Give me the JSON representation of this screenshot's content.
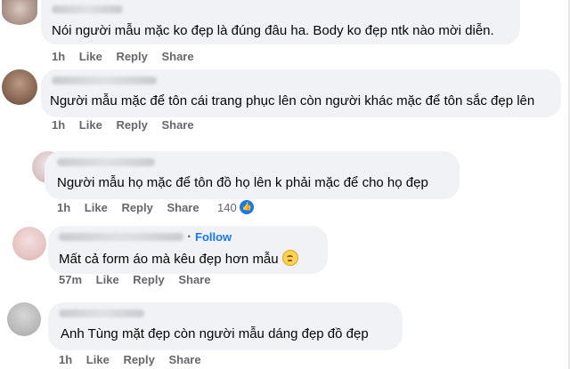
{
  "comments": [
    {
      "text": "Nói người mẫu mặc ko đẹp là đúng đâu ha. Body ko đẹp ntk nào mời diễn.",
      "time": "1h",
      "like": "Like",
      "reply": "Reply",
      "share": "Share"
    },
    {
      "text": "Người mẫu mặc để tôn cái trang phục lên còn người khác mặc để tôn sắc đẹp lên",
      "time": "1h",
      "like": "Like",
      "reply": "Reply",
      "share": "Share"
    },
    {
      "text": "Người mẫu họ mặc để tôn đồ họ lên k phải mặc để cho họ đẹp",
      "time": "1h",
      "like": "Like",
      "reply": "Reply",
      "share": "Share",
      "reaction_count": "140",
      "reaction_icon": "like-reaction-icon"
    },
    {
      "text": "Mất cả form áo mà kêu đẹp hơn mẫu",
      "time": "57m",
      "like": "Like",
      "reply": "Reply",
      "share": "Share",
      "follow": "Follow",
      "separator": "·",
      "emoji": "flushed-face-emoji"
    },
    {
      "text": "Anh Tùng mặt đẹp còn người mẫu dáng đẹp đồ đẹp",
      "time": "1h",
      "like": "Like",
      "reply": "Reply",
      "share": "Share"
    }
  ],
  "colors": {
    "bubble": "#f0f2f5",
    "action_text": "#65676b",
    "link_blue": "#1877f2",
    "body_text": "#050505"
  }
}
